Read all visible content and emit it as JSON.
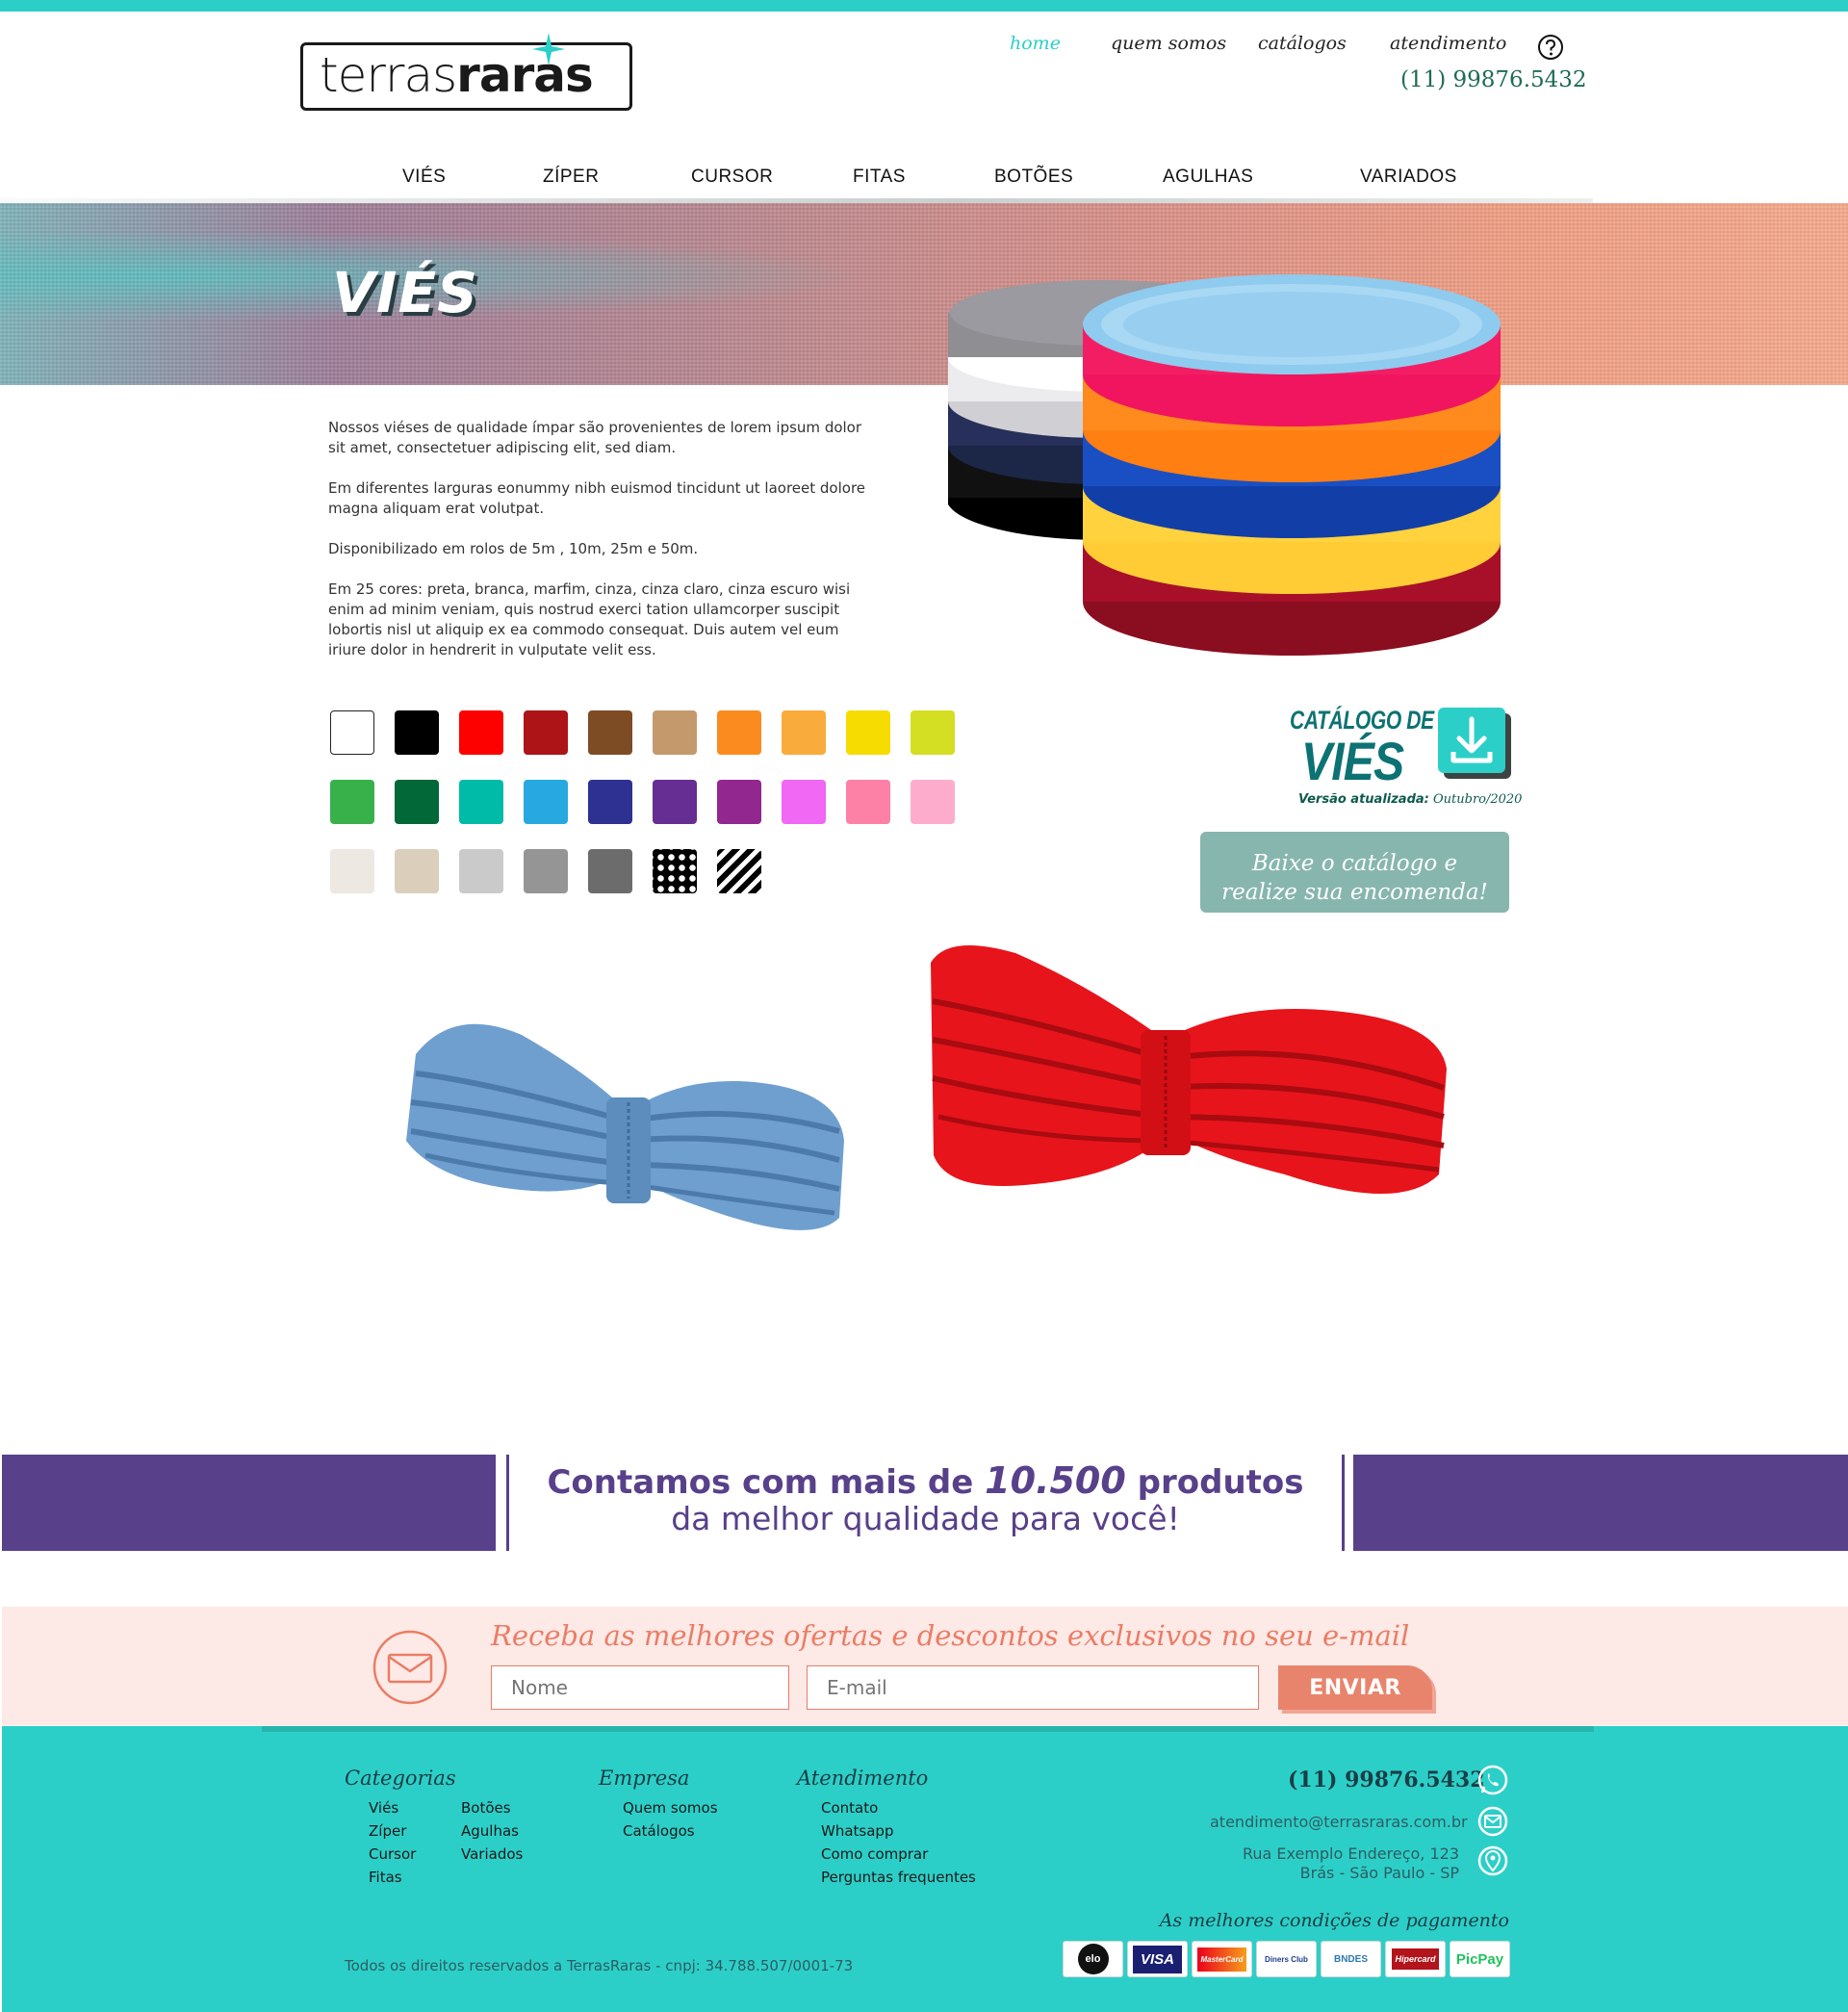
{
  "brand": {
    "logo_light": "terras",
    "logo_bold": "raras",
    "accent": "#2ccfc8",
    "purple": "#58408a",
    "coral": "#ea7d65"
  },
  "topnav": {
    "items": [
      "home",
      "quem somos",
      "catálogos",
      "atendimento"
    ],
    "active": "home",
    "phone": "(11) 99876.5432"
  },
  "catnav": [
    "VIÉS",
    "ZÍPER",
    "CURSOR",
    "FITAS",
    "BOTÕES",
    "AGULHAS",
    "VARIADOS"
  ],
  "banner": {
    "title": "VIÉS"
  },
  "intro": [
    "Nossos viéses de qualidade ímpar são provenientes de lorem ipsum dolor sit amet, consectetuer adipiscing elit, sed diam.",
    "Em diferentes larguras eonummy nibh euismod tincidunt ut laoreet dolore magna aliquam erat volutpat.",
    "Disponibilizado em rolos de 5m , 10m, 25m e 50m.",
    "Em 25 cores: preta, branca, marfim, cinza, cinza claro, cinza escuro wisi enim ad minim veniam, quis nostrud exerci tation ullamcorper suscipit lobortis nisl ut aliquip ex ea commodo consequat. Duis autem vel eum iriure dolor in hendrerit in vulputate velit ess."
  ],
  "swatches": [
    "#ffffff",
    "#000000",
    "#fd0000",
    "#ad1418",
    "#7d4c25",
    "#c49a6c",
    "#fb8b1f",
    "#f9ab3c",
    "#f6dc00",
    "#d4de22",
    "#38b14a",
    "#026838",
    "#00bba7",
    "#28a8e0",
    "#2e3191",
    "#662e92",
    "#922790",
    "#f068f4",
    "#fd80a7",
    "#feaccb",
    "#ede8e2",
    "#dbcfbc",
    "#cacaca",
    "#959595",
    "#6c6c6c",
    "dots",
    "stripes"
  ],
  "catalog": {
    "title_line1": "CATÁLOGO DE",
    "title_line2": "VIÉS",
    "version_label": "Versão atualizada:",
    "version_value": "Outubro/2020",
    "button_line1": "Baixe o catálogo e",
    "button_line2": "realize sua encomenda!",
    "icon": "download-icon"
  },
  "band": {
    "line1_a": "Contamos com mais de ",
    "line1_num": "10.500",
    "line1_b": " produtos",
    "line2": "da melhor qualidade para você!"
  },
  "newsletter": {
    "title": "Receba as melhores ofertas e descontos exclusivos no seu e-mail",
    "name_placeholder": "Nome",
    "email_placeholder": "E-mail",
    "button": "ENVIAR"
  },
  "footer": {
    "categorias": {
      "title": "Categorias",
      "col1": [
        "Viés",
        "Zíper",
        "Cursor",
        "Fitas"
      ],
      "col2": [
        "Botões",
        "Agulhas",
        "Variados"
      ]
    },
    "empresa": {
      "title": "Empresa",
      "items": [
        "Quem somos",
        "Catálogos"
      ]
    },
    "atendimento": {
      "title": "Atendimento",
      "items": [
        "Contato",
        "Whatsapp",
        "Como comprar",
        "Perguntas frequentes"
      ]
    },
    "phone": "(11) 99876.5432",
    "email": "atendimento@terrasraras.com.br",
    "address_line1": "Rua Exemplo Endereço, 123",
    "address_line2": "Brás - São Paulo - SP",
    "payments_title": "As melhores condições de pagamento",
    "payments": [
      "elo",
      "VISA",
      "MasterCard",
      "Diners Club",
      "BNDES",
      "Hipercard",
      "PicPay"
    ],
    "copyright": "Todos os direitos reservados a TerrasRaras - cnpj: 34.788.507/0001-73"
  }
}
